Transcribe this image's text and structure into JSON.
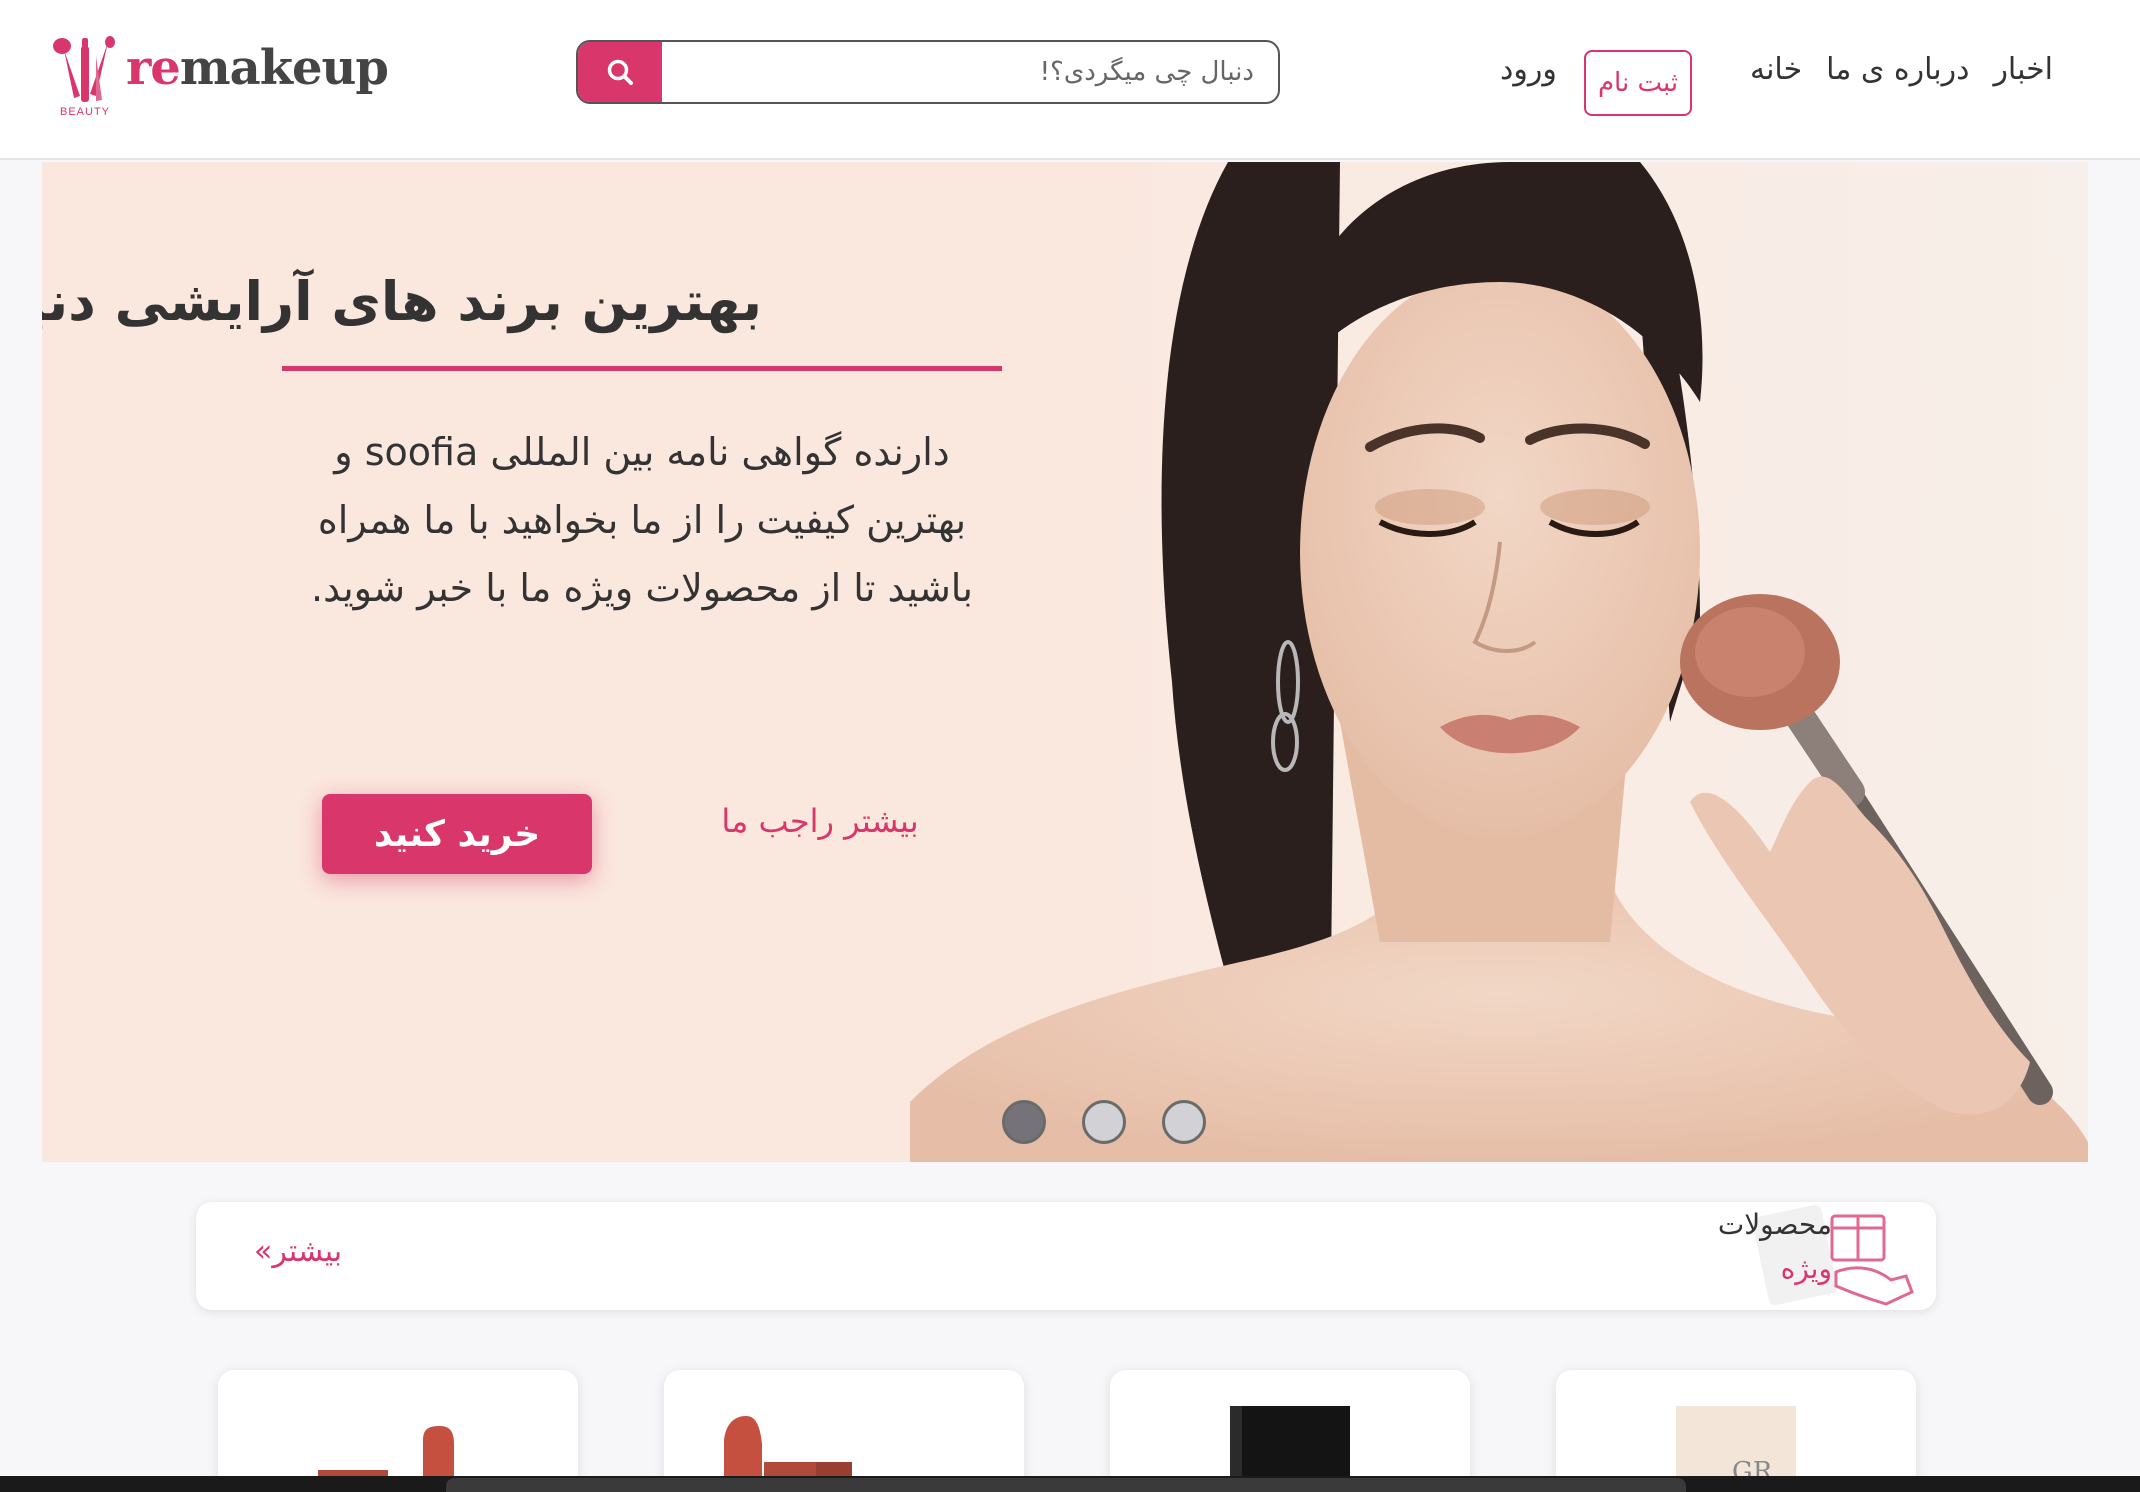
{
  "header": {
    "logo": {
      "brand_accent": "re",
      "brand_rest": "makeup",
      "sub": "BEAUTY"
    },
    "search": {
      "placeholder": "دنبال چی میگردی؟!",
      "icon": "search-icon"
    },
    "nav": {
      "login": "ورود",
      "register": "ثبت نام",
      "links": [
        "خانه",
        "درباره ی ما",
        "اخبار"
      ]
    }
  },
  "hero": {
    "title": "بهترین برند های آرایشی دنیا",
    "text": "دارنده گواهی نامه بین المللی soofia و بهترین کیفیت را از ما بخواهید با ما همراه باشید تا از محصولات ویژه ما با خبر شوید.",
    "buy_label": "خرید کنید",
    "more_label": "بیشتر راجب ما",
    "slides": {
      "count": 3,
      "active": 1
    }
  },
  "featured": {
    "title_line1": "محصولات",
    "title_line2": "ویژه",
    "more_label": "بیشتر»"
  },
  "colors": {
    "accent": "#d9366b",
    "hero_bg": "#fae7dd",
    "text": "#333333",
    "page_bg": "#f7f7f9"
  }
}
